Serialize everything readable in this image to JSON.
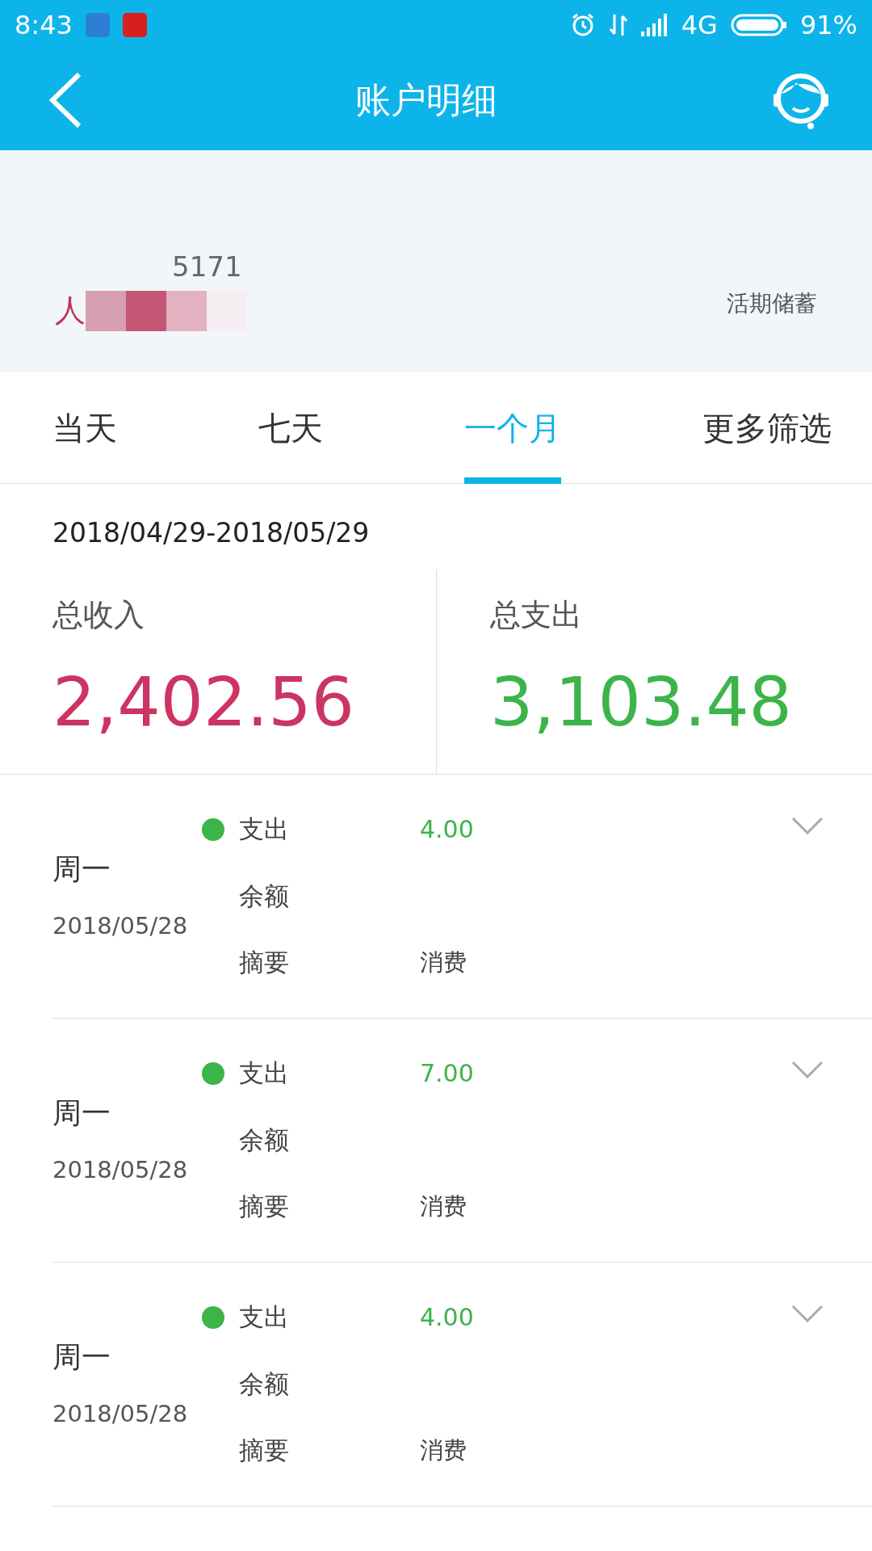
{
  "status_bar": {
    "time": "8:43",
    "network": "4G",
    "battery": "91%"
  },
  "header": {
    "title": "账户明细"
  },
  "account": {
    "number_fragment": "5171",
    "currency_fragment": "人",
    "type": "活期储蓄"
  },
  "tabs": [
    {
      "label": "当天",
      "selected": false
    },
    {
      "label": "七天",
      "selected": false
    },
    {
      "label": "一个月",
      "selected": true
    },
    {
      "label": "更多筛选",
      "selected": false
    }
  ],
  "period": "2018/04/29-2018/05/29",
  "totals": [
    {
      "label": "总收入",
      "amount": "2,402.56",
      "kind": "income"
    },
    {
      "label": "总支出",
      "amount": "3,103.48",
      "kind": "expense"
    }
  ],
  "transactions": [
    {
      "weekday": "周一",
      "date": "2018/05/28",
      "type_label": "支出",
      "amount": "4.00",
      "balance_label": "余额",
      "summary_label": "摘要",
      "summary": "消费",
      "color": "#3cb44a"
    },
    {
      "weekday": "周一",
      "date": "2018/05/28",
      "type_label": "支出",
      "amount": "7.00",
      "balance_label": "余额",
      "summary_label": "摘要",
      "summary": "消费",
      "color": "#3cb44a"
    },
    {
      "weekday": "周一",
      "date": "2018/05/28",
      "type_label": "支出",
      "amount": "4.00",
      "balance_label": "余额",
      "summary_label": "摘要",
      "summary": "消费",
      "color": "#3cb44a"
    }
  ]
}
